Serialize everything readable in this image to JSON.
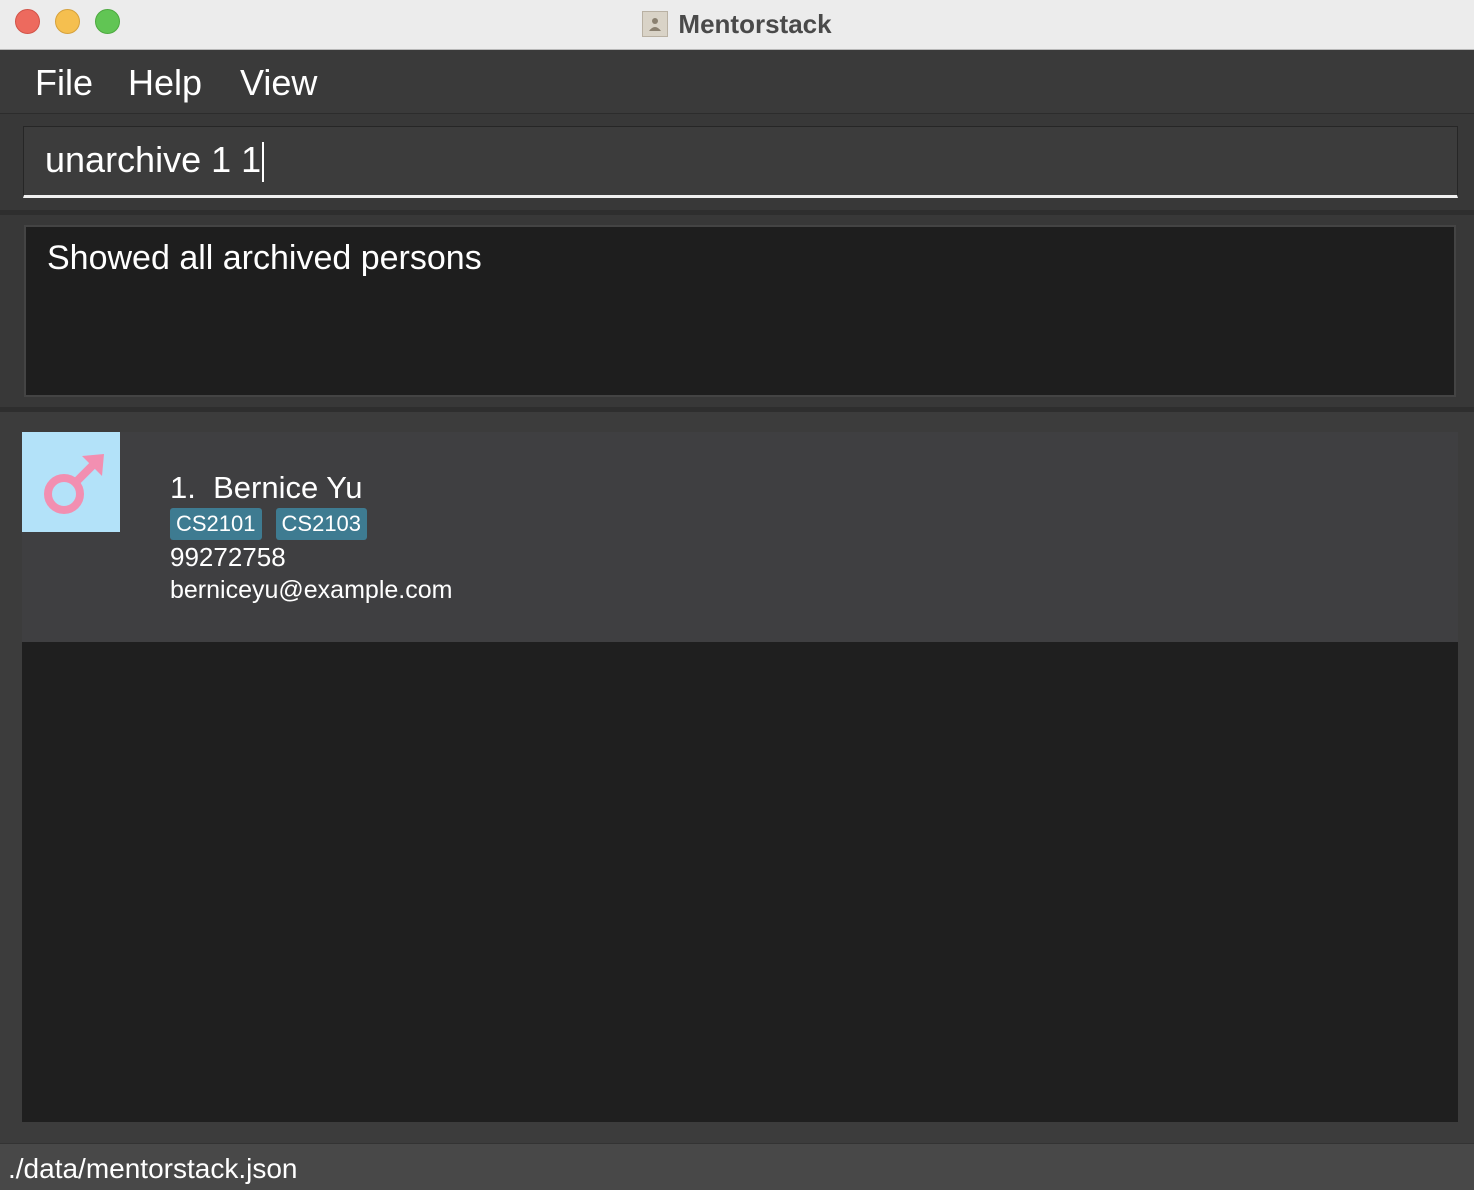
{
  "window": {
    "title": "Mentorstack"
  },
  "menu": {
    "items": [
      "File",
      "Help",
      "View"
    ]
  },
  "command": {
    "value": "unarchive 1 1"
  },
  "result": {
    "message": "Showed all archived persons"
  },
  "persons": [
    {
      "index": "1.",
      "name": "Bernice Yu",
      "tags": [
        "CS2101",
        "CS2103"
      ],
      "phone": "99272758",
      "email": "berniceyu@example.com",
      "avatar_icon": "male-icon",
      "avatar_color": "#b3e2f9",
      "icon_color": "#f28fb1"
    }
  ],
  "status": {
    "file_path": "./data/mentorstack.json"
  },
  "colors": {
    "tag_bg": "#3e7b91",
    "background": "#1f1f1f",
    "card": "#3f3f41"
  }
}
